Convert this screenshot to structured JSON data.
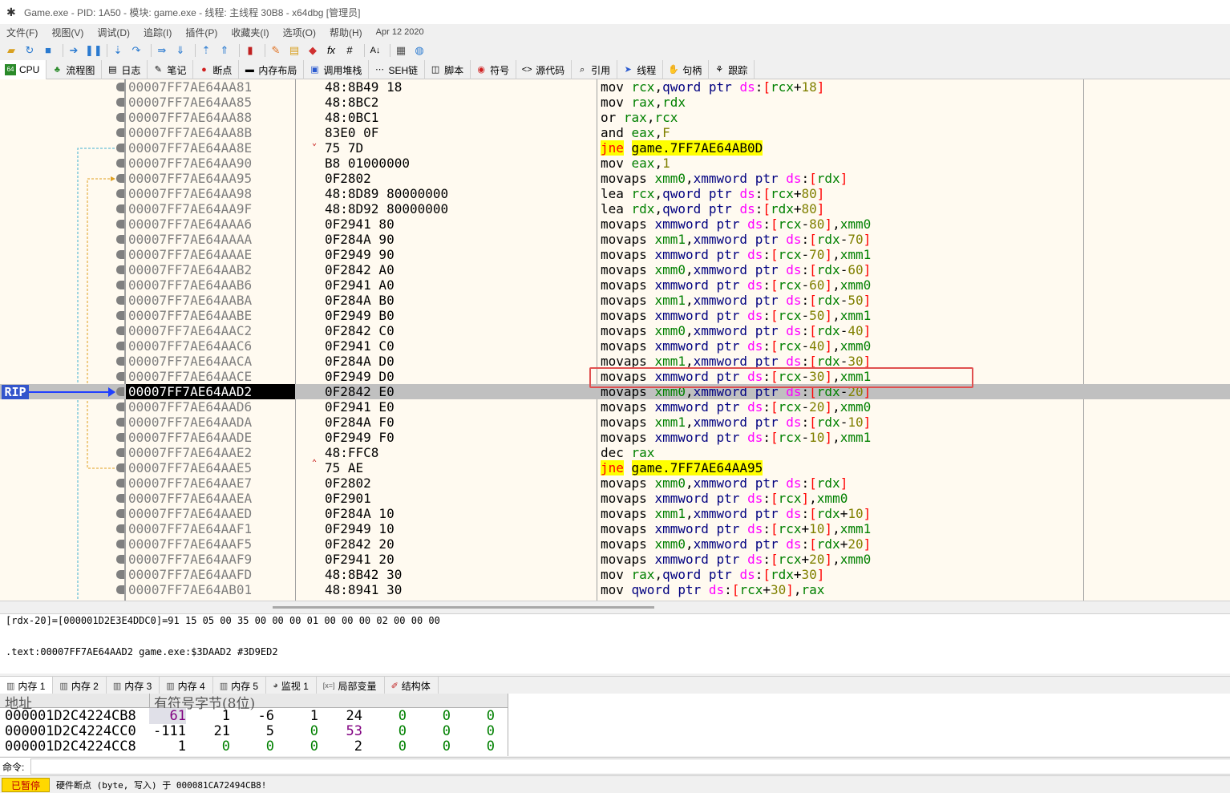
{
  "titlebar": {
    "title": "Game.exe - PID: 1A50 - 模块: game.exe - 线程: 主线程 30B8 - x64dbg [管理员]"
  },
  "menu": [
    "文件(F)",
    "视图(V)",
    "调试(D)",
    "追踪(I)",
    "插件(P)",
    "收藏夹(I)",
    "选项(O)",
    "帮助(H)",
    "Apr 12 2020"
  ],
  "tabs": [
    {
      "label": "CPU",
      "icon": "cpu-icon"
    },
    {
      "label": "流程图",
      "icon": "graph-icon"
    },
    {
      "label": "日志",
      "icon": "log-icon"
    },
    {
      "label": "笔记",
      "icon": "notes-icon"
    },
    {
      "label": "断点",
      "icon": "breakpoint-icon"
    },
    {
      "label": "内存布局",
      "icon": "memory-map-icon"
    },
    {
      "label": "调用堆栈",
      "icon": "call-stack-icon"
    },
    {
      "label": "SEH链",
      "icon": "seh-icon"
    },
    {
      "label": "脚本",
      "icon": "script-icon"
    },
    {
      "label": "符号",
      "icon": "symbols-icon"
    },
    {
      "label": "源代码",
      "icon": "source-icon"
    },
    {
      "label": "引用",
      "icon": "references-icon"
    },
    {
      "label": "线程",
      "icon": "threads-icon"
    },
    {
      "label": "句柄",
      "icon": "handles-icon"
    },
    {
      "label": "跟踪",
      "icon": "trace-icon"
    }
  ],
  "disasm": {
    "rip_label": "RIP",
    "rows": [
      {
        "addr": "00007FF7AE64AA81",
        "bytes": "48:8B49 18",
        "instr": "mov rcx,qword ptr ds:[rcx+18]"
      },
      {
        "addr": "00007FF7AE64AA85",
        "bytes": "48:8BC2",
        "instr": "mov rax,rdx"
      },
      {
        "addr": "00007FF7AE64AA88",
        "bytes": "48:0BC1",
        "instr": "or rax,rcx"
      },
      {
        "addr": "00007FF7AE64AA8B",
        "bytes": "83E0 0F",
        "instr": "and eax,F"
      },
      {
        "addr": "00007FF7AE64AA8E",
        "bytes": "75 7D",
        "instr": "jne game.7FF7AE64AB0D",
        "jump": true,
        "mark": "down"
      },
      {
        "addr": "00007FF7AE64AA90",
        "bytes": "B8 01000000",
        "instr": "mov eax,1"
      },
      {
        "addr": "00007FF7AE64AA95",
        "bytes": "0F2802",
        "instr": "movaps xmm0,xmmword ptr ds:[rdx]"
      },
      {
        "addr": "00007FF7AE64AA98",
        "bytes": "48:8D89 80000000",
        "instr": "lea rcx,qword ptr ds:[rcx+80]"
      },
      {
        "addr": "00007FF7AE64AA9F",
        "bytes": "48:8D92 80000000",
        "instr": "lea rdx,qword ptr ds:[rdx+80]"
      },
      {
        "addr": "00007FF7AE64AAA6",
        "bytes": "0F2941 80",
        "instr": "movaps xmmword ptr ds:[rcx-80],xmm0"
      },
      {
        "addr": "00007FF7AE64AAAA",
        "bytes": "0F284A 90",
        "instr": "movaps xmm1,xmmword ptr ds:[rdx-70]"
      },
      {
        "addr": "00007FF7AE64AAAE",
        "bytes": "0F2949 90",
        "instr": "movaps xmmword ptr ds:[rcx-70],xmm1"
      },
      {
        "addr": "00007FF7AE64AAB2",
        "bytes": "0F2842 A0",
        "instr": "movaps xmm0,xmmword ptr ds:[rdx-60]"
      },
      {
        "addr": "00007FF7AE64AAB6",
        "bytes": "0F2941 A0",
        "instr": "movaps xmmword ptr ds:[rcx-60],xmm0"
      },
      {
        "addr": "00007FF7AE64AABA",
        "bytes": "0F284A B0",
        "instr": "movaps xmm1,xmmword ptr ds:[rdx-50]"
      },
      {
        "addr": "00007FF7AE64AABE",
        "bytes": "0F2949 B0",
        "instr": "movaps xmmword ptr ds:[rcx-50],xmm1"
      },
      {
        "addr": "00007FF7AE64AAC2",
        "bytes": "0F2842 C0",
        "instr": "movaps xmm0,xmmword ptr ds:[rdx-40]"
      },
      {
        "addr": "00007FF7AE64AAC6",
        "bytes": "0F2941 C0",
        "instr": "movaps xmmword ptr ds:[rcx-40],xmm0"
      },
      {
        "addr": "00007FF7AE64AACA",
        "bytes": "0F284A D0",
        "instr": "movaps xmm1,xmmword ptr ds:[rdx-30]"
      },
      {
        "addr": "00007FF7AE64AACE",
        "bytes": "0F2949 D0",
        "instr": "movaps xmmword ptr ds:[rcx-30],xmm1"
      },
      {
        "addr": "00007FF7AE64AAD2",
        "bytes": "0F2842 E0",
        "instr": "movaps xmm0,xmmword ptr ds:[rdx-20]",
        "rip": true
      },
      {
        "addr": "00007FF7AE64AAD6",
        "bytes": "0F2941 E0",
        "instr": "movaps xmmword ptr ds:[rcx-20],xmm0"
      },
      {
        "addr": "00007FF7AE64AADA",
        "bytes": "0F284A F0",
        "instr": "movaps xmm1,xmmword ptr ds:[rdx-10]"
      },
      {
        "addr": "00007FF7AE64AADE",
        "bytes": "0F2949 F0",
        "instr": "movaps xmmword ptr ds:[rcx-10],xmm1"
      },
      {
        "addr": "00007FF7AE64AAE2",
        "bytes": "48:FFC8",
        "instr": "dec rax"
      },
      {
        "addr": "00007FF7AE64AAE5",
        "bytes": "75 AE",
        "instr": "jne game.7FF7AE64AA95",
        "jump": true,
        "mark": "up"
      },
      {
        "addr": "00007FF7AE64AAE7",
        "bytes": "0F2802",
        "instr": "movaps xmm0,xmmword ptr ds:[rdx]"
      },
      {
        "addr": "00007FF7AE64AAEA",
        "bytes": "0F2901",
        "instr": "movaps xmmword ptr ds:[rcx],xmm0"
      },
      {
        "addr": "00007FF7AE64AAED",
        "bytes": "0F284A 10",
        "instr": "movaps xmm1,xmmword ptr ds:[rdx+10]"
      },
      {
        "addr": "00007FF7AE64AAF1",
        "bytes": "0F2949 10",
        "instr": "movaps xmmword ptr ds:[rcx+10],xmm1"
      },
      {
        "addr": "00007FF7AE64AAF5",
        "bytes": "0F2842 20",
        "instr": "movaps xmm0,xmmword ptr ds:[rdx+20]"
      },
      {
        "addr": "00007FF7AE64AAF9",
        "bytes": "0F2941 20",
        "instr": "movaps xmmword ptr ds:[rcx+20],xmm0"
      },
      {
        "addr": "00007FF7AE64AAFD",
        "bytes": "48:8B42 30",
        "instr": "mov rax,qword ptr ds:[rdx+30]"
      },
      {
        "addr": "00007FF7AE64AB01",
        "bytes": "48:8941 30",
        "instr": "mov qword ptr ds:[rcx+30],rax"
      }
    ]
  },
  "info": {
    "line1": "[rdx-20]=[000001D2E3E4DDC0]=91 15 05 00 35 00 00 00 01 00 00 00 02 00 00 00",
    "line2": ".text:00007FF7AE64AAD2 game.exe:$3DAAD2 #3D9ED2"
  },
  "bottom_tabs": [
    {
      "label": "内存 1",
      "icon": "memory-icon"
    },
    {
      "label": "内存 2",
      "icon": "memory-icon"
    },
    {
      "label": "内存 3",
      "icon": "memory-icon"
    },
    {
      "label": "内存 4",
      "icon": "memory-icon"
    },
    {
      "label": "内存 5",
      "icon": "memory-icon"
    },
    {
      "label": "监视 1",
      "icon": "watch-icon"
    },
    {
      "label": "局部变量",
      "icon": "locals-icon"
    },
    {
      "label": "结构体",
      "icon": "struct-icon"
    }
  ],
  "dump": {
    "col_addr": "地址",
    "col_data": "有符号字节(8位)",
    "rows": [
      {
        "addr": "000001D2C4224CB8",
        "values": [
          "61",
          "1",
          "-6",
          "1",
          "24",
          "0",
          "0",
          "0"
        ]
      },
      {
        "addr": "000001D2C4224CC0",
        "values": [
          "-111",
          "21",
          "5",
          "0",
          "53",
          "0",
          "0",
          "0"
        ]
      },
      {
        "addr": "000001D2C4224CC8",
        "values": [
          "1",
          "0",
          "0",
          "0",
          "2",
          "0",
          "0",
          "0"
        ]
      }
    ]
  },
  "command": {
    "label": "命令:",
    "value": ""
  },
  "status": {
    "state": "已暂停",
    "message": "硬件断点 (byte, 写入) 于 000081CA72494CB8!"
  }
}
